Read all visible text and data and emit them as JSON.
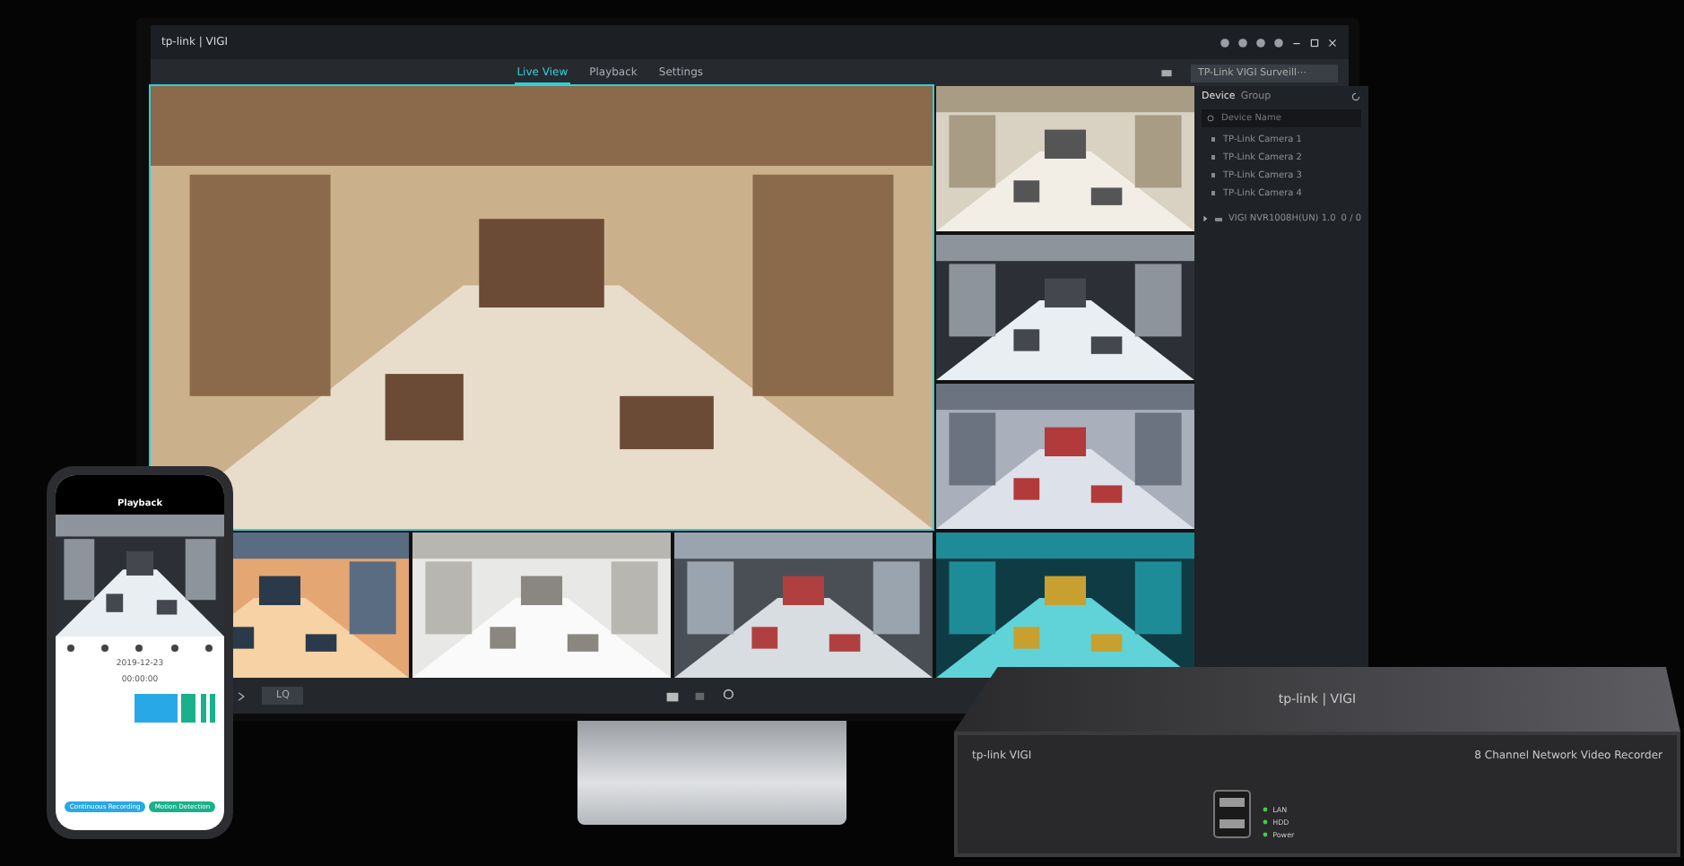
{
  "monitor": {
    "logo": "tp-link | VIGI",
    "tabs": [
      {
        "label": "Live View",
        "selected": true
      },
      {
        "label": "Playback",
        "selected": false
      },
      {
        "label": "Settings",
        "selected": false
      }
    ],
    "profile": "TP-Link VIGI Surveill⋯",
    "sidebar": {
      "tabs": [
        {
          "label": "Device",
          "selected": true
        },
        {
          "label": "Group",
          "selected": false
        }
      ],
      "search": {
        "placeholder": "Device Name"
      },
      "cameras": [
        "TP-Link Camera 1",
        "TP-Link Camera 2",
        "TP-Link Camera 3",
        "TP-Link Camera 4"
      ],
      "recorder": {
        "name": "VIGI NVR1008H(UN) 1.0",
        "count": "0 / 0"
      }
    },
    "quality": "LQ"
  },
  "phone": {
    "title": "Playback",
    "date": "2019-12-23",
    "time": "00:00:00",
    "buttons": [
      {
        "label": "Continuous Recording",
        "color": "#29a8e8"
      },
      {
        "label": "Motion Detection",
        "color": "#19b08a"
      }
    ]
  },
  "recorder": {
    "top_logo": "tp-link | VIGI",
    "front_logo": "tp-link VIGI",
    "model": "8 Channel Network Video Recorder",
    "leds": [
      "LAN",
      "HDD",
      "Power"
    ]
  }
}
